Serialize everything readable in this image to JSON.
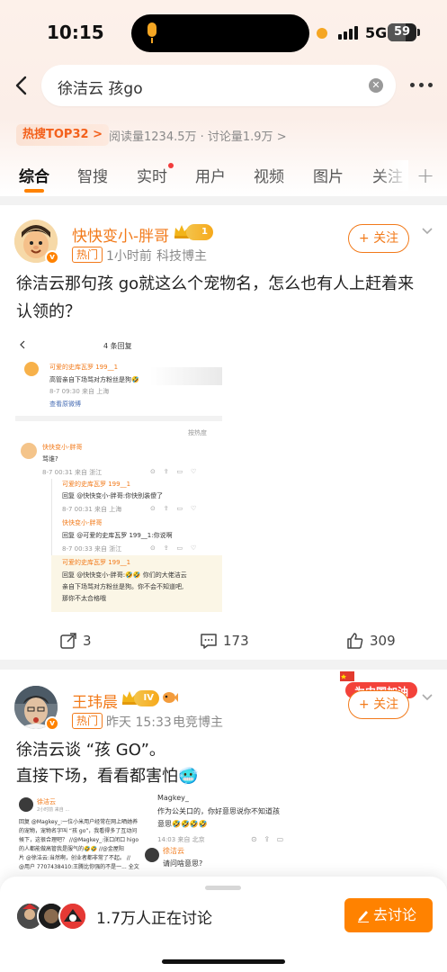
{
  "status_bar": {
    "time": "10:15",
    "network": "5G",
    "battery": "59"
  },
  "search": {
    "query": "徐洁云 孩go"
  },
  "hot": {
    "badge": "热搜TOP32 >",
    "stats": "阅读量1234.5万 · 讨论量1.9万 >"
  },
  "tabs": [
    "综合",
    "智搜",
    "实时",
    "用户",
    "视频",
    "图片",
    "关注"
  ],
  "posts": [
    {
      "username": "快快变小-胖哥",
      "level": "1",
      "tag": "热门",
      "time": "1小时前",
      "source": "科技博主",
      "follow": "+ 关注",
      "text": "徐洁云那句孩 go就这么个宠物名，怎么也有人上赶着来认领的？",
      "shot": {
        "title": "4 条回复",
        "top_user": "可爱的史库瓦罗 199__1",
        "top_text": "高管亲自下场骂对方粉丝是狗🤣",
        "top_meta": "8-7 09:30 来自 上海",
        "view_origin": "查看原微博",
        "sort": "按热度",
        "r1_user": "快快变小-胖哥",
        "r1_text": "骂谁?",
        "r1_meta": "8-7 00:31 来自 浙江",
        "r2_user": "可爱的史库瓦罗 199__1",
        "r2_text": "回复 @快快变小-胖哥:你快别装傻了",
        "r2_meta": "8-7 00:31 来自 上海",
        "r3_user": "快快变小-胖哥",
        "r3_text": "回复 @可爱的史库瓦罗 199__1:你说啊",
        "r3_meta": "8-7 00:33 来自 浙江",
        "r4_user": "可爱的史库瓦罗 199__1",
        "r4_text1": "回复 @快快变小-胖哥:🤣🤣 你们的大佬洁云",
        "r4_text2": "亲自下场骂对方粉丝是狗。你不会不知道吧,",
        "r4_text3": "那你不太合格哦"
      },
      "reposts": "3",
      "comments": "173",
      "likes": "309"
    },
    {
      "username": "王玮晨",
      "level": "IV",
      "tag": "热门",
      "time": "昨天 15:33",
      "source": "电竞博主",
      "follow": "+ 关注",
      "banner": "为中国加油",
      "text_line1": "徐洁云谈 “孩 GO”。",
      "text_line2": "直接下场，看看都害怕🥶",
      "shot": {
        "user": "徐洁云",
        "meta": "2小时前 来自 ...",
        "l1": "回复 @Magkey_:一位小米用户经常在网上晒她养",
        "l2": "的宠物，宠物名字叫 “孩 go”，我看得多了互动问",
        "l3": "候下，这很合理吧？ //@Magkey_:张口闭口 higo",
        "l4": "的人都能做高管我是服气的🤣🤣 //@金屋阳",
        "l5": "片 @徐洁云:当然啊，创业者都非常了不起。 //",
        "l6": "@用户 7707438410:王腾比你强的不是一... 全文",
        "r_user": "Magkey_",
        "r_l1": "作为公关口的，你好意思说你不知道孩",
        "r_l2": "意思🤣🤣🤣🤣",
        "r_meta": "14:03 来自 北京",
        "r2_user": "徐洁云",
        "r2_text": "请问啥意思?"
      }
    }
  ],
  "bottom": {
    "discussing": "1.7万人正在讨论",
    "button": "去讨论"
  }
}
